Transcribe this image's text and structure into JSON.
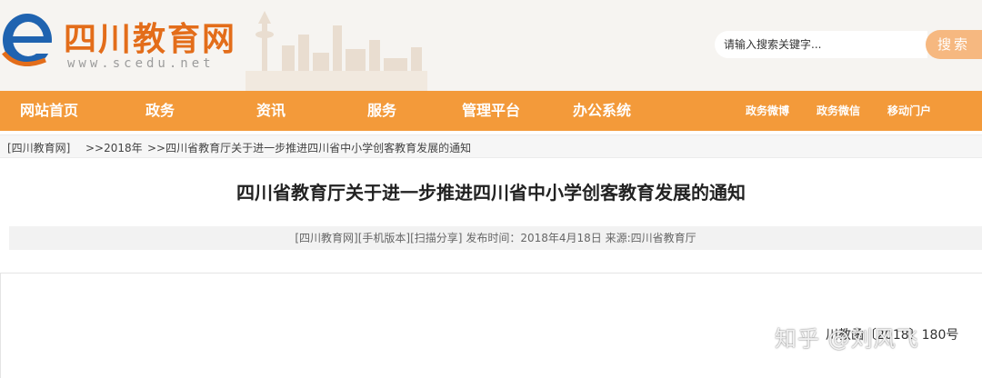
{
  "header": {
    "site_name": "四川教育网",
    "site_url": "www.scedu.net",
    "search_placeholder": "请输入搜索关键字...",
    "search_button": "搜索"
  },
  "nav": {
    "items": [
      "网站首页",
      "政务",
      "资讯",
      "服务",
      "管理平台",
      "办公系统"
    ],
    "right_items": [
      "政务微博",
      "政务微信",
      "移动门户"
    ]
  },
  "breadcrumb": {
    "items": [
      "[四川教育网]",
      ">>2018年",
      ">>四川省教育厅关于进一步推进四川省中小学创客教育发展的通知"
    ]
  },
  "article": {
    "title": "四川省教育厅关于进一步推进四川省中小学创客教育发展的通知",
    "meta": {
      "link1": "[四川教育网]",
      "link2": "[手机版本]",
      "link3": "[扫描分享]",
      "publish_time": "发布时间：2018年4月18日",
      "source": "来源:四川省教育厅"
    },
    "doc_number": "川教函〔2018〕180号"
  },
  "watermark": "知乎 @刘风飞",
  "colors": {
    "brand_orange": "#e36d1a",
    "nav_orange": "#f39a3a",
    "search_button": "#f6b880",
    "logo_blue": "#1f63b0"
  }
}
